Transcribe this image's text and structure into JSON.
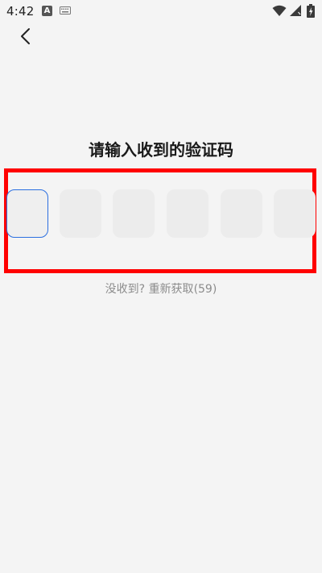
{
  "status_bar": {
    "time": "4:42",
    "app_badge": "A"
  },
  "title": "请输入收到的验证码",
  "code_inputs": {
    "count": 6,
    "active_index": 0,
    "values": [
      "",
      "",
      "",
      "",
      "",
      ""
    ]
  },
  "resend": {
    "prompt": "没收到?",
    "action": "重新获取",
    "countdown": "(59)"
  },
  "colors": {
    "background": "#f4f4f4",
    "active_border": "#2b6fe0",
    "highlight": "#ff0000",
    "box_fill": "#ececec",
    "hint_text": "#8c8c8c"
  },
  "icons": {
    "back": "chevron-left-icon",
    "wifi": "wifi-icon",
    "signal": "signal-icon",
    "battery": "battery-charging-icon",
    "keyboard": "keyboard-icon"
  }
}
